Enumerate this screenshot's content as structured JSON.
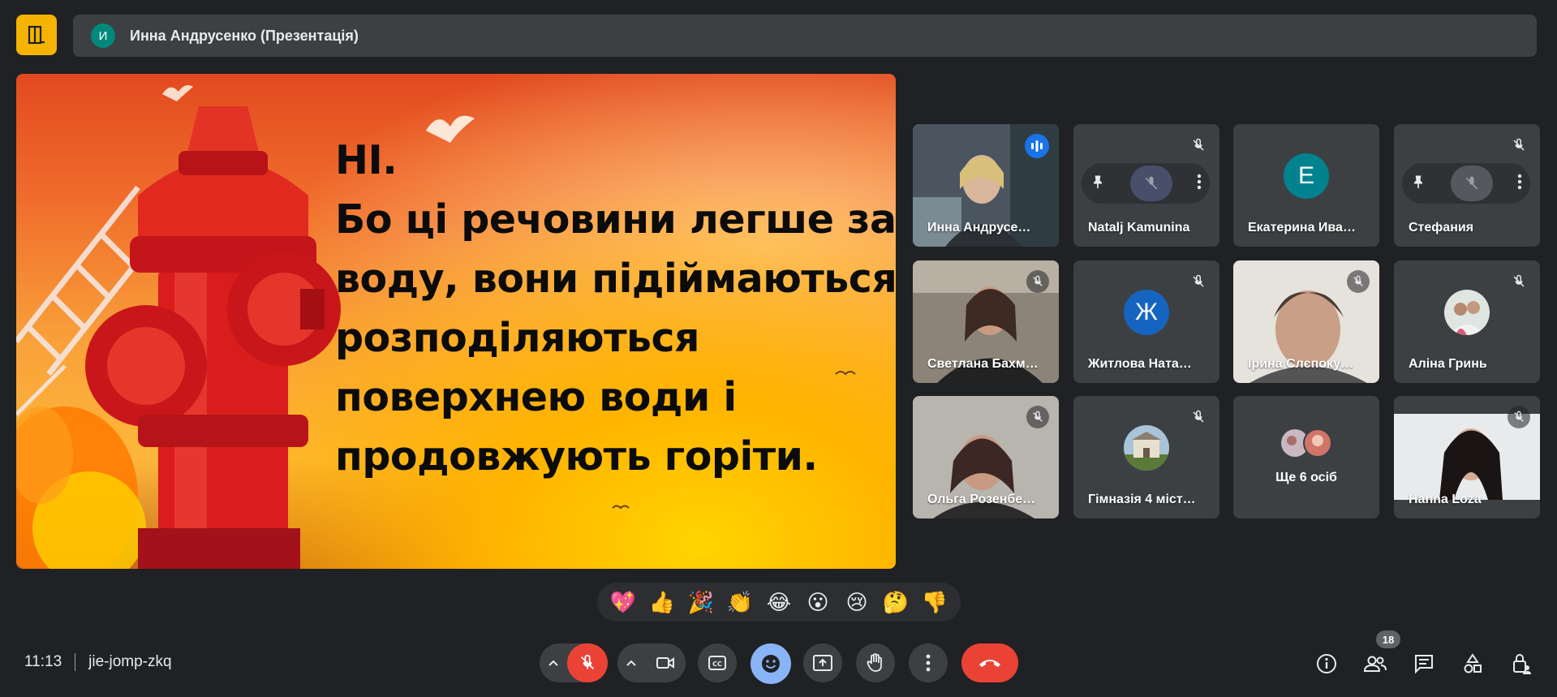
{
  "header": {
    "avatar_letter": "И",
    "presenter_title": "Инна Андрусенко (Презентація)"
  },
  "slide": {
    "lines": [
      "НІ.",
      "Бо ці речовини легше за",
      "воду, вони підіймаються,",
      "розподіляються",
      "поверхнею води і",
      "продовжують горіти."
    ]
  },
  "participants": [
    {
      "name": "Инна Андрусенко",
      "display": "Инна Андрусе…",
      "type": "video",
      "speaking": true
    },
    {
      "name": "Natalj Kamunina",
      "display": "Natalj Kamunina",
      "type": "hover"
    },
    {
      "name": "Екатерина Ива…",
      "display": "Екатерина Ива…",
      "type": "letter",
      "letter": "Е",
      "color": "#00838f"
    },
    {
      "name": "Стефания",
      "display": "Стефания",
      "type": "hover"
    },
    {
      "name": "Светлана Бахм…",
      "display": "Светлана Бахм…",
      "type": "video"
    },
    {
      "name": "Житлова Ната…",
      "display": "Житлова Ната…",
      "type": "letter",
      "letter": "Ж",
      "color": "#1565c0"
    },
    {
      "name": "Ірина Слєпоку…",
      "display": "Ірина Слєпоку…",
      "type": "video"
    },
    {
      "name": "Аліна Гринь",
      "display": "Аліна Гринь",
      "type": "photo"
    },
    {
      "name": "Ольга Розенбе…",
      "display": "Ольга Розенбе…",
      "type": "video"
    },
    {
      "name": "Гімназія 4 міст…",
      "display": "Гімназія 4 міст…",
      "type": "photo"
    },
    {
      "name": "Ще 6 осіб",
      "display": "Ще 6 осіб",
      "type": "more"
    },
    {
      "name": "Hanna Loza",
      "display": "Hanna Loza",
      "type": "video"
    }
  ],
  "reactions": [
    "💖",
    "👍",
    "🎉",
    "👏",
    "😂",
    "😮",
    "😢",
    "🤔",
    "👎"
  ],
  "footer": {
    "time": "11:13",
    "meeting_code": "jie-jomp-zkq",
    "participant_count": "18"
  },
  "colors": {
    "background": "#202124",
    "tile": "#3c4043",
    "end_call": "#ea4335",
    "active_blue": "#8ab4f8"
  }
}
